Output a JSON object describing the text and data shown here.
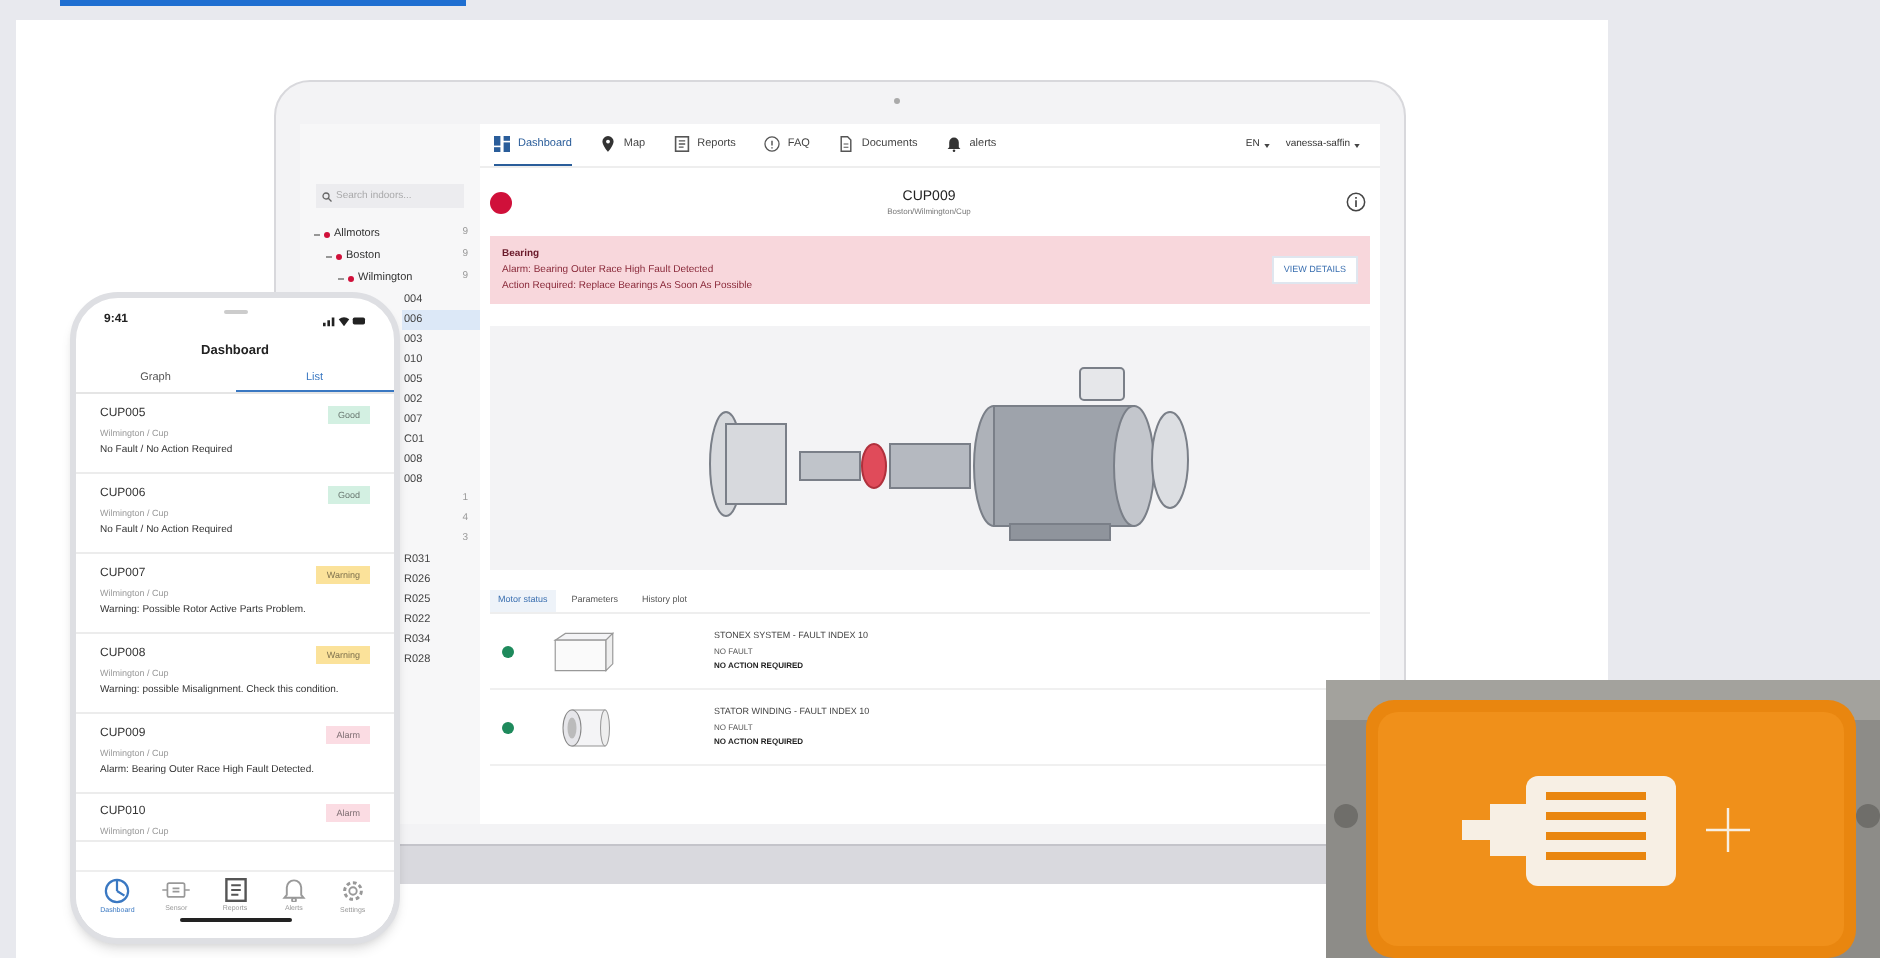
{
  "laptop": {
    "nav_tabs": [
      {
        "label": "Dashboard",
        "selected": true
      },
      {
        "label": "Map",
        "selected": false
      },
      {
        "label": "Reports",
        "selected": false
      },
      {
        "label": "FAQ",
        "selected": false
      },
      {
        "label": "Documents",
        "selected": false
      },
      {
        "label": "alerts",
        "selected": false
      }
    ],
    "language": "EN",
    "user": "vanessa-saffin",
    "sidebar": {
      "search_placeholder": "Search indoors...",
      "tree": [
        {
          "label": "Allmotors",
          "count": "9",
          "color": "#d0103a",
          "children": [
            {
              "label": "Boston",
              "count": "9",
              "color": "#d0103a",
              "children": [
                {
                  "label": "Wilmington",
                  "count": "9",
                  "color": "#d0103a"
                }
              ]
            }
          ]
        }
      ],
      "items": [
        {
          "label": "004",
          "selected": false
        },
        {
          "label": "006",
          "selected": true
        },
        {
          "label": "003",
          "selected": false
        },
        {
          "label": "010",
          "selected": false
        },
        {
          "label": "005",
          "selected": false
        },
        {
          "label": "002",
          "selected": false
        },
        {
          "label": "007",
          "selected": false
        },
        {
          "label": "C01",
          "selected": false
        },
        {
          "label": "008",
          "selected": false
        },
        {
          "label": "008",
          "selected": false
        },
        {
          "count": "1",
          "selected": false
        },
        {
          "count": "4",
          "selected": false
        },
        {
          "count": "3",
          "selected": false
        },
        {
          "label": "R031",
          "selected": false
        },
        {
          "label": "R026",
          "selected": false
        },
        {
          "label": "R025",
          "selected": false
        },
        {
          "label": "R022",
          "selected": false
        },
        {
          "label": "R034",
          "selected": false
        },
        {
          "label": "R028",
          "selected": false
        }
      ]
    },
    "asset": {
      "name": "CUP009",
      "path": "Boston/Wilmington/Cup",
      "color": "#d0103a"
    },
    "alert": {
      "title": "Bearing",
      "lines": [
        "Alarm: Bearing Outer Race High Fault Detected",
        "Action Required: Replace Bearings As Soon As Possible"
      ],
      "button": "VIEW DETAILS"
    },
    "detail_tabs": [
      {
        "label": "Motor status",
        "selected": true
      },
      {
        "label": "Parameters",
        "selected": false
      },
      {
        "label": "History plot",
        "selected": false
      }
    ],
    "components": [
      {
        "kind": "box",
        "color": "#1e8a5c",
        "title": "STONEX SYSTEM - FAULT INDEX 10",
        "fault": "NO FAULT",
        "action": "NO ACTION REQUIRED"
      },
      {
        "kind": "cylinder",
        "color": "#1e8a5c",
        "title": "STATOR WINDING - FAULT INDEX 10",
        "fault": "NO FAULT",
        "action": "NO ACTION REQUIRED"
      }
    ]
  },
  "phone": {
    "time": "9:41",
    "title": "Dashboard",
    "tabs": [
      {
        "label": "Graph",
        "selected": false
      },
      {
        "label": "List",
        "selected": true
      }
    ],
    "items": [
      {
        "name": "CUP005",
        "location": "Wilmington / Cup",
        "message": "No Fault / No Action Required",
        "color": "#d3f0e2",
        "badge": "Good"
      },
      {
        "name": "CUP006",
        "location": "Wilmington / Cup",
        "message": "No Fault / No Action Required",
        "color": "#d3f0e2",
        "badge": "Good"
      },
      {
        "name": "CUP007",
        "location": "Wilmington / Cup",
        "message": "Warning: Possible Rotor Active Parts Problem.",
        "color": "#fbe29a",
        "badge": "Warning"
      },
      {
        "name": "CUP008",
        "location": "Wilmington / Cup",
        "message": "Warning: possible Misalignment. Check this condition.",
        "color": "#fbe29a",
        "badge": "Warning"
      },
      {
        "name": "CUP009",
        "location": "Wilmington / Cup",
        "message": "Alarm: Bearing Outer Race High Fault Detected.",
        "color": "#fbdce3",
        "badge": "Alarm"
      },
      {
        "name": "CUP010",
        "location": "Wilmington / Cup",
        "color": "#fbdce3",
        "badge": "Alarm"
      }
    ],
    "nav": [
      {
        "label": "Dashboard",
        "selected": true
      },
      {
        "label": "Sensor",
        "selected": false
      },
      {
        "label": "Reports",
        "selected": false
      },
      {
        "label": "Alerts",
        "selected": false
      },
      {
        "label": "Settings",
        "selected": false
      }
    ]
  }
}
